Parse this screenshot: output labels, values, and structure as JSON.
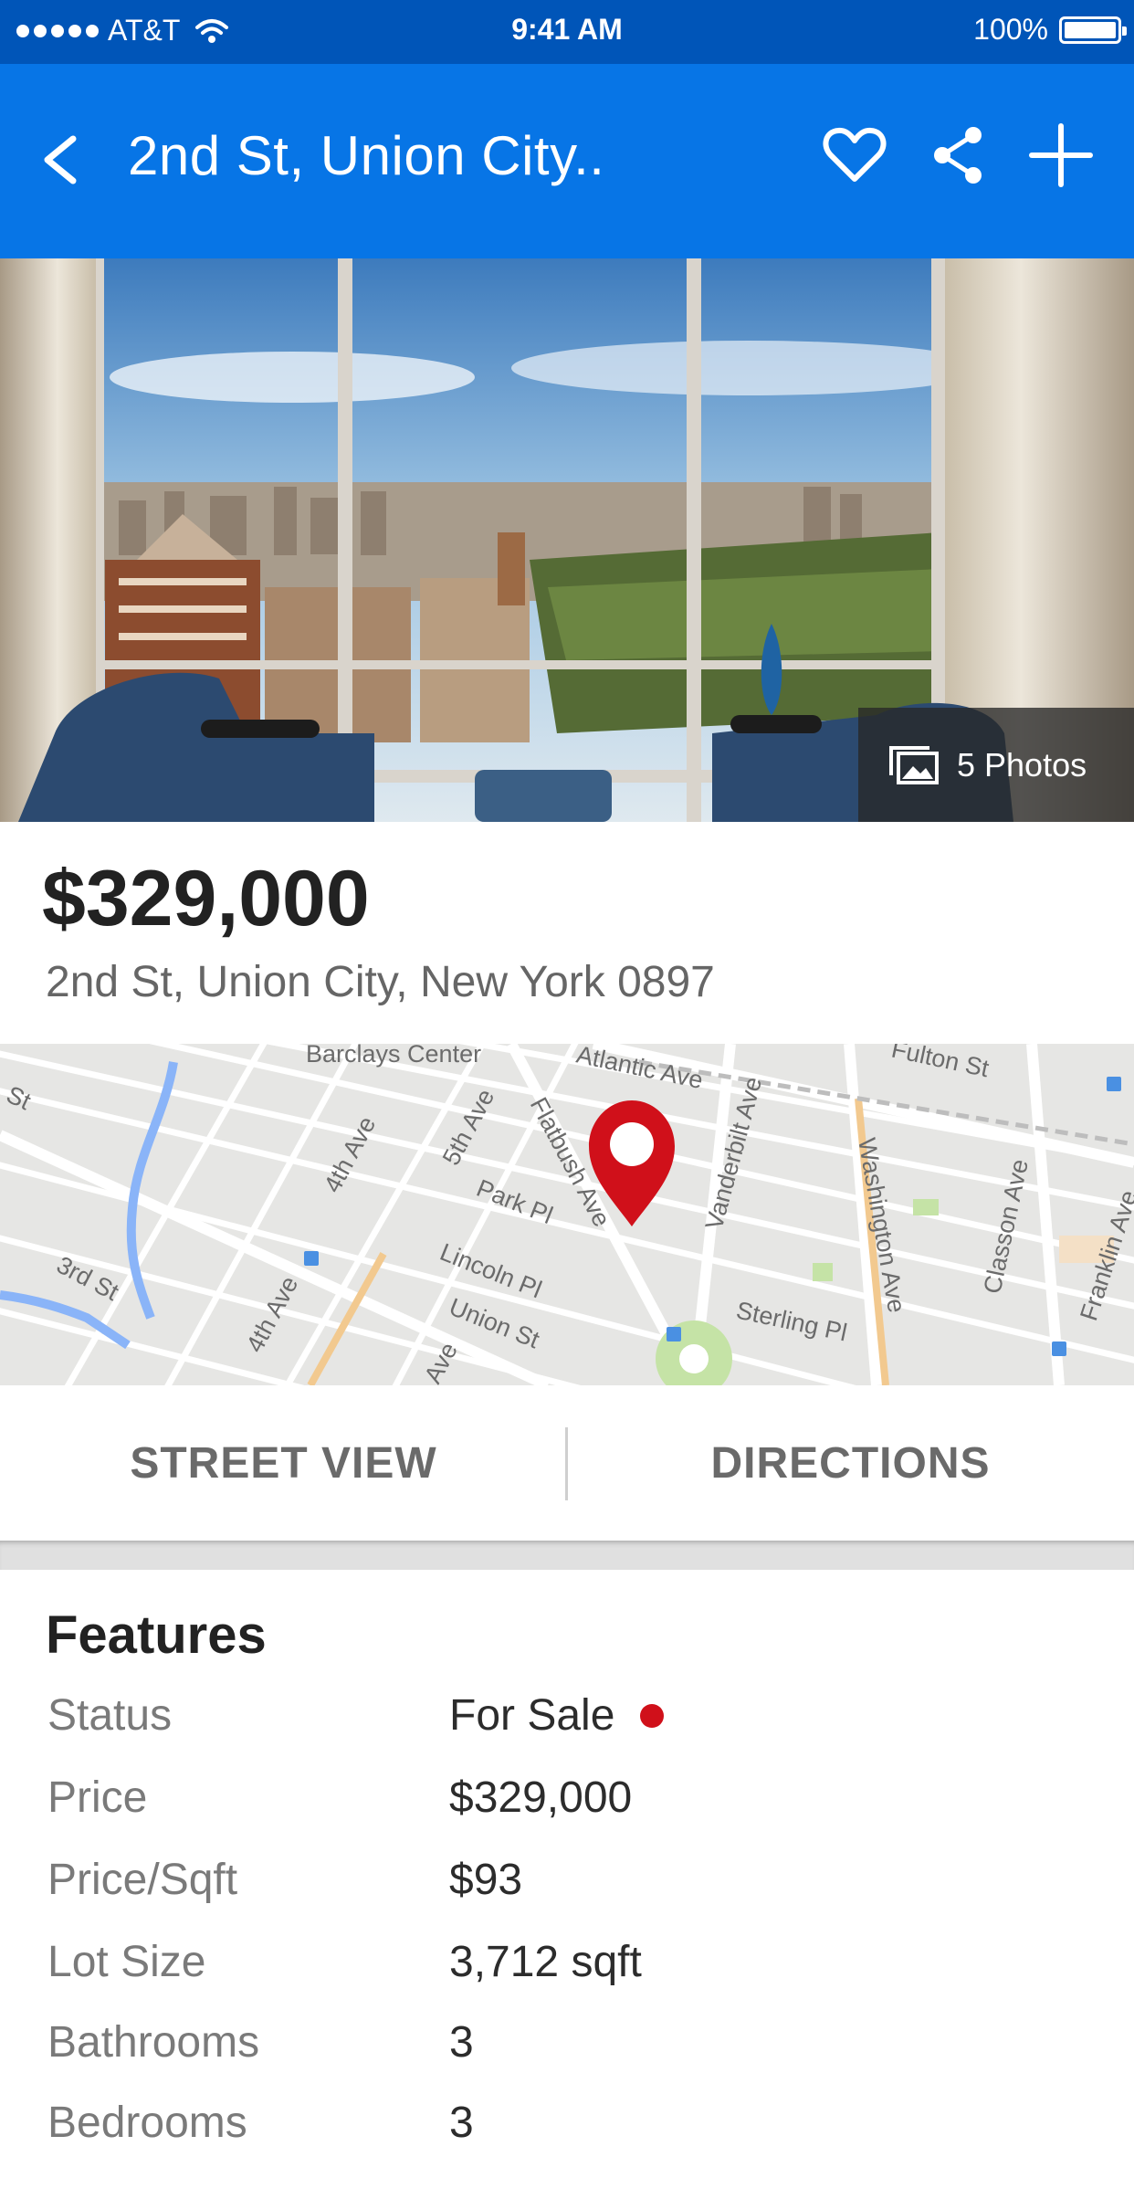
{
  "status_bar": {
    "carrier": "AT&T",
    "time": "9:41 AM",
    "battery": "100%"
  },
  "app_bar": {
    "title": "2nd St, Union City.."
  },
  "hero": {
    "photos_label": "5 Photos"
  },
  "listing": {
    "price": "$329,000",
    "address": "2nd St, Union City, New York 0897"
  },
  "map": {
    "labels": {
      "barclays": "Barclays Center",
      "atlantic": "Atlantic Ave",
      "fulton": "Fulton St",
      "st_left": "St",
      "fourth_ave_top": "4th Ave",
      "fifth_ave": "5th Ave",
      "flatbush": "Flatbush Ave",
      "park_pl": "Park Pl",
      "vanderbilt": "Vanderbilt Ave",
      "washington": "Washington Ave",
      "classon": "Classon Ave",
      "franklin": "Franklin Ave",
      "third_st": "3rd St",
      "lincoln_pl": "Lincoln Pl",
      "union_st": "Union St",
      "fourth_ave_bottom": "4th Ave",
      "ave_fragment": "Ave",
      "sterling_pl": "Sterling Pl"
    }
  },
  "actions": {
    "street_view": "STREET VIEW",
    "directions": "DIRECTIONS"
  },
  "features": {
    "title": "Features",
    "rows": [
      {
        "label": "Status",
        "value": "For Sale"
      },
      {
        "label": "Price",
        "value": "$329,000"
      },
      {
        "label": "Price/Sqft",
        "value": "$93"
      },
      {
        "label": "Lot Size",
        "value": "3,712 sqft"
      },
      {
        "label": "Bathrooms",
        "value": "3"
      },
      {
        "label": "Bedrooms",
        "value": "3"
      }
    ]
  },
  "colors": {
    "status_bar": "#0055b8",
    "app_bar": "#0775e6",
    "status_dot": "#d0101a",
    "map_pin": "#d0101a"
  },
  "icons": [
    "back-icon",
    "heart-icon",
    "share-icon",
    "add-icon",
    "gallery-icon",
    "map-pin-icon",
    "wifi-icon",
    "battery-icon"
  ]
}
